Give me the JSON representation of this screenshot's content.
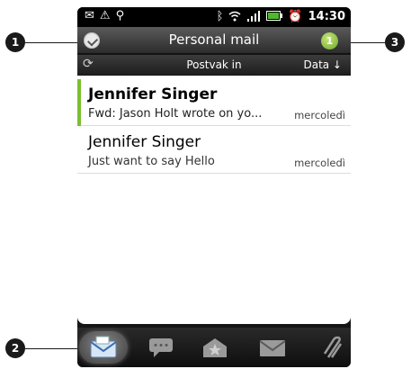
{
  "status_bar": {
    "time": "14:30",
    "icons": [
      "message-icon",
      "warning-icon",
      "usb-icon",
      "bluetooth-icon",
      "wifi-icon",
      "signal-icon",
      "battery-icon",
      "alarm-icon"
    ]
  },
  "header": {
    "title": "Personal mail",
    "unread_count": "1"
  },
  "folder_bar": {
    "folder": "Postvak in",
    "sort": "Data ↓"
  },
  "messages": [
    {
      "sender": "Jennifer Singer",
      "subject": "Fwd: Jason Holt wrote on yo...",
      "date": "mercoledì",
      "unread": true
    },
    {
      "sender": "Jennifer Singer",
      "subject": "Just want to say Hello",
      "date": "mercoledì",
      "unread": false
    }
  ],
  "tabs": [
    "inbox-tab",
    "conversations-tab",
    "favorites-tab",
    "unread-tab",
    "attachments-tab"
  ],
  "callouts": [
    "1",
    "2",
    "3"
  ],
  "colors": {
    "accent": "#7bbf2f",
    "badge": "#6fa82a"
  }
}
